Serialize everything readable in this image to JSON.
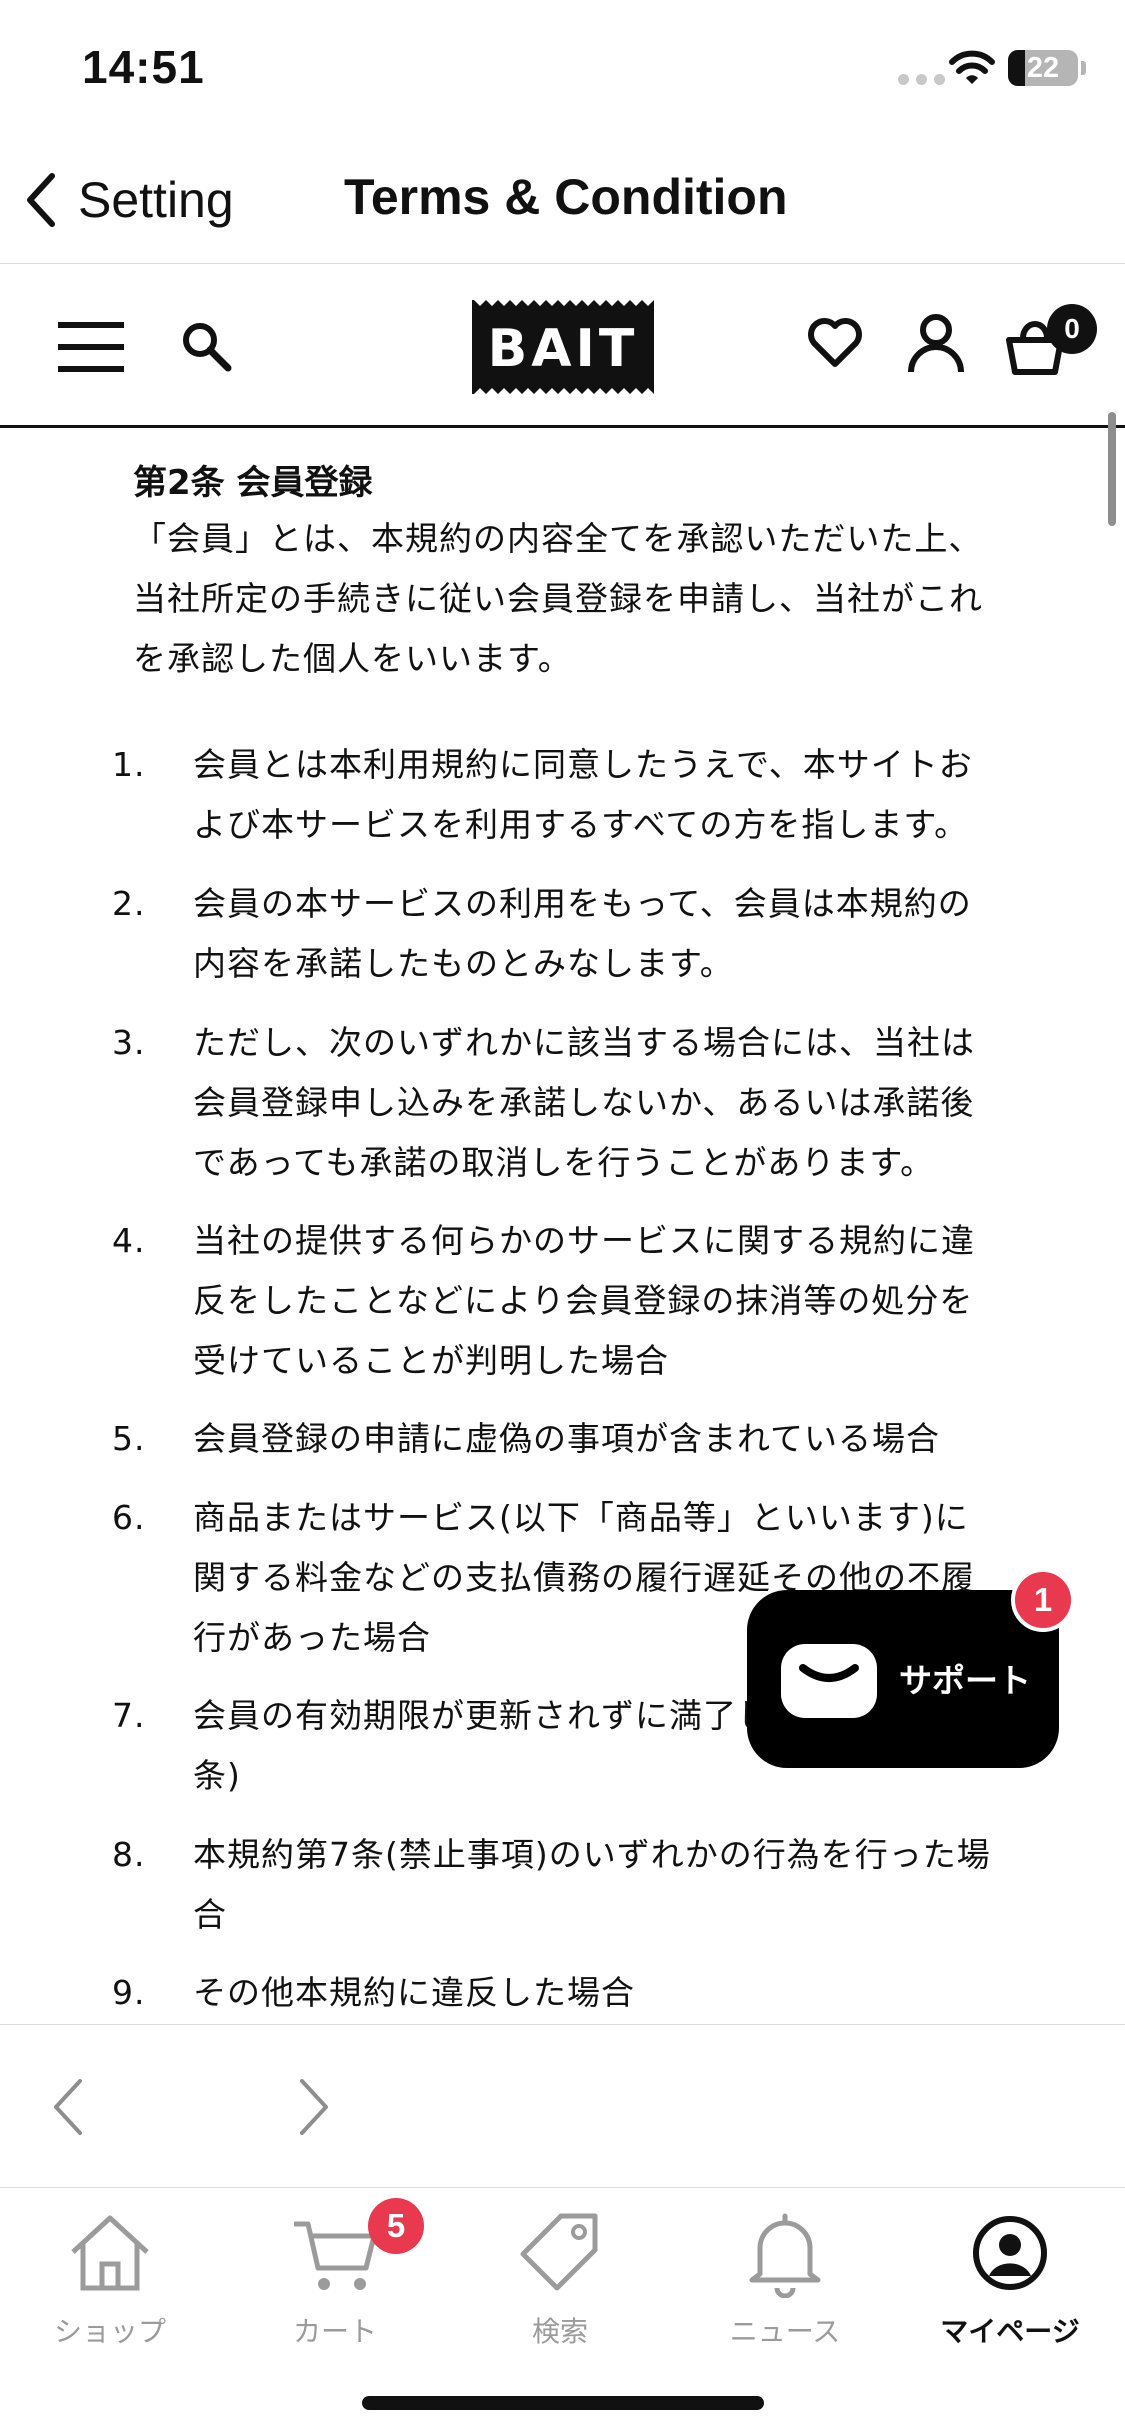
{
  "status_bar": {
    "time": "14:51",
    "battery": "22"
  },
  "nav": {
    "back_label": "Setting",
    "title": "Terms & Condition"
  },
  "site_header": {
    "logo_text": "BAIT",
    "cart_count": "0"
  },
  "article": {
    "title": "第2条 会員登録",
    "intro": "「会員」とは、本規約の内容全てを承認いただいた上、当社所定の手続きに従い会員登録を申請し、当社がこれを承認した個人をいいます。",
    "items": [
      {
        "num": "1.",
        "text": "会員とは本利用規約に同意したうえで、本サイトおよび本サービスを利用するすべての方を指します。"
      },
      {
        "num": "2.",
        "text": "会員の本サービスの利用をもって、会員は本規約の内容を承諾したものとみなします。"
      },
      {
        "num": "3.",
        "text": "ただし、次のいずれかに該当する場合には、当社は会員登録申し込みを承諾しないか、あるいは承諾後であっても承諾の取消しを行うことがあります。"
      },
      {
        "num": "4.",
        "text": "当社の提供する何らかのサービスに関する規約に違反をしたことなどにより会員登録の抹消等の処分を受けていることが判明した場合"
      },
      {
        "num": "5.",
        "text": "会員登録の申請に虚偽の事項が含まれている場合"
      },
      {
        "num": "6.",
        "text": "商品またはサービス(以下「商品等」といいます)に関する料金などの支払債務の履行遅延その他の不履行があった場合"
      },
      {
        "num": "7.",
        "text": "会員の有効期限が更新されずに満了し"
      },
      {
        "num": "",
        "text": "条)"
      },
      {
        "num": "8.",
        "text": "本規約第7条(禁止事項)のいずれかの行為を行った場合"
      },
      {
        "num": "9.",
        "text": "その他本規約に違反した場合"
      }
    ]
  },
  "support": {
    "label": "サポート",
    "badge": "1"
  },
  "tabs": [
    {
      "label": "ショップ",
      "icon": "home-icon"
    },
    {
      "label": "カート",
      "icon": "cart-icon",
      "badge": "5"
    },
    {
      "label": "検索",
      "icon": "tag-icon"
    },
    {
      "label": "ニュース",
      "icon": "bell-icon"
    },
    {
      "label": "マイページ",
      "icon": "profile-icon"
    }
  ],
  "colors": {
    "badge_red": "#e8394f",
    "active": "#111111",
    "inactive": "#9b9b9b"
  }
}
